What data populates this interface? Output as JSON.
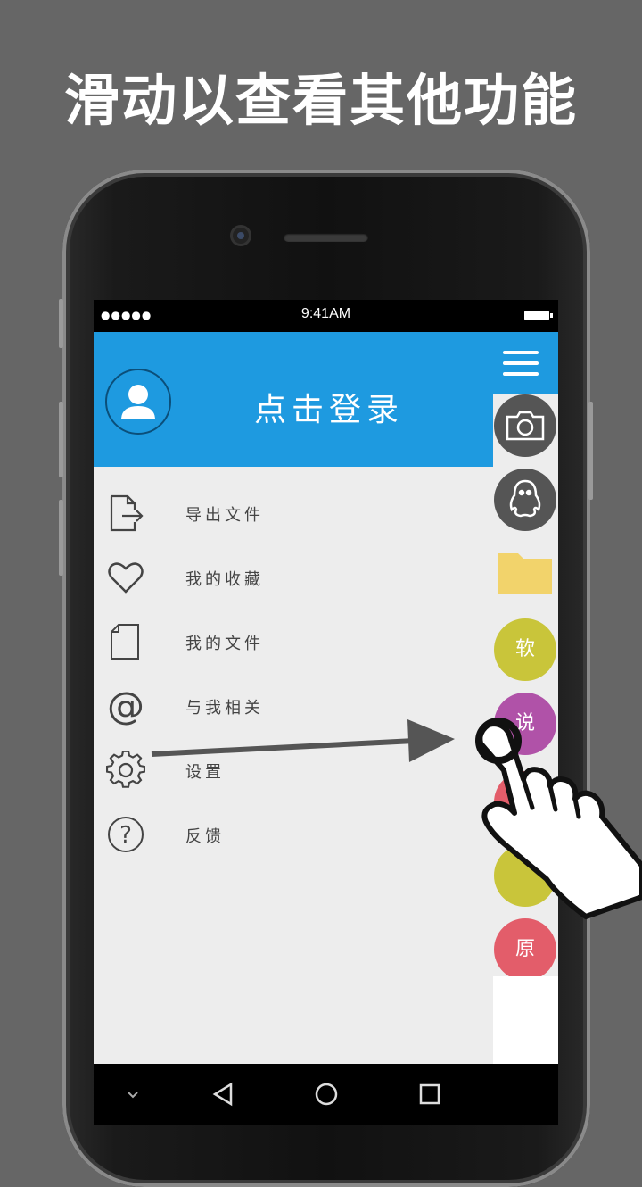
{
  "headline": "滑动以查看其他功能",
  "status_bar": {
    "signal": "●●●●●",
    "time": "9:41AM"
  },
  "drawer": {
    "login_label": "点击登录",
    "items": [
      {
        "label": "导出文件",
        "icon": "export-file-icon"
      },
      {
        "label": "我的收藏",
        "icon": "heart-icon"
      },
      {
        "label": "我的文件",
        "icon": "file-icon"
      },
      {
        "label": "与我相关",
        "icon": "at-icon"
      },
      {
        "label": "设置",
        "icon": "gear-icon"
      },
      {
        "label": "反馈",
        "icon": "help-icon"
      }
    ]
  },
  "side_strip": {
    "circles": [
      {
        "label": "软",
        "color": "#c9c53a"
      },
      {
        "label": "说",
        "color": "#b052a8"
      },
      {
        "label": "原",
        "color": "#e35d6a"
      }
    ],
    "icons": [
      "camera-icon",
      "qq-icon",
      "folder-icon"
    ]
  },
  "colors": {
    "accent": "#1e9ae0",
    "background": "#666666",
    "folder": "#f2d36b"
  },
  "nav_bar": {
    "icons": [
      "chevron-down-icon",
      "back-icon",
      "home-icon",
      "recents-icon"
    ]
  }
}
